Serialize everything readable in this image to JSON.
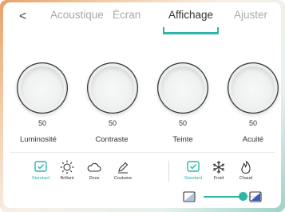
{
  "header": {
    "back_glyph": "<",
    "tabs": [
      {
        "label": "Acoustique"
      },
      {
        "label": "Écran"
      },
      {
        "label": "Affichage"
      },
      {
        "label": "Ajuster"
      }
    ],
    "active_tab": "Affichage"
  },
  "knobs": [
    {
      "label": "Luminosité",
      "value": "50"
    },
    {
      "label": "Contraste",
      "value": "50"
    },
    {
      "label": "Teinte",
      "value": "50"
    },
    {
      "label": "Acuité",
      "value": "50"
    }
  ],
  "modes": {
    "picture": [
      {
        "label": "Standard",
        "icon": "check-square-icon",
        "selected": true
      },
      {
        "label": "Brillant",
        "icon": "sun-icon",
        "selected": false
      },
      {
        "label": "Doux",
        "icon": "cloud-icon",
        "selected": false
      },
      {
        "label": "Coutume",
        "icon": "pencil-icon",
        "selected": false
      }
    ],
    "color_temp": [
      {
        "label": "Standard",
        "icon": "check-square-icon",
        "selected": true
      },
      {
        "label": "Froid",
        "icon": "snowflake-icon",
        "selected": false
      },
      {
        "label": "Chaud",
        "icon": "flame-icon",
        "selected": false
      }
    ]
  },
  "blue_light_slider": {
    "value_fraction": 0.72,
    "left_icon": "low-blue-light-icon",
    "right_icon": "high-blue-light-icon"
  },
  "colors": {
    "accent": "#2fb5a8",
    "text": "#333333",
    "inactive_tab": "#a9a9a9"
  }
}
